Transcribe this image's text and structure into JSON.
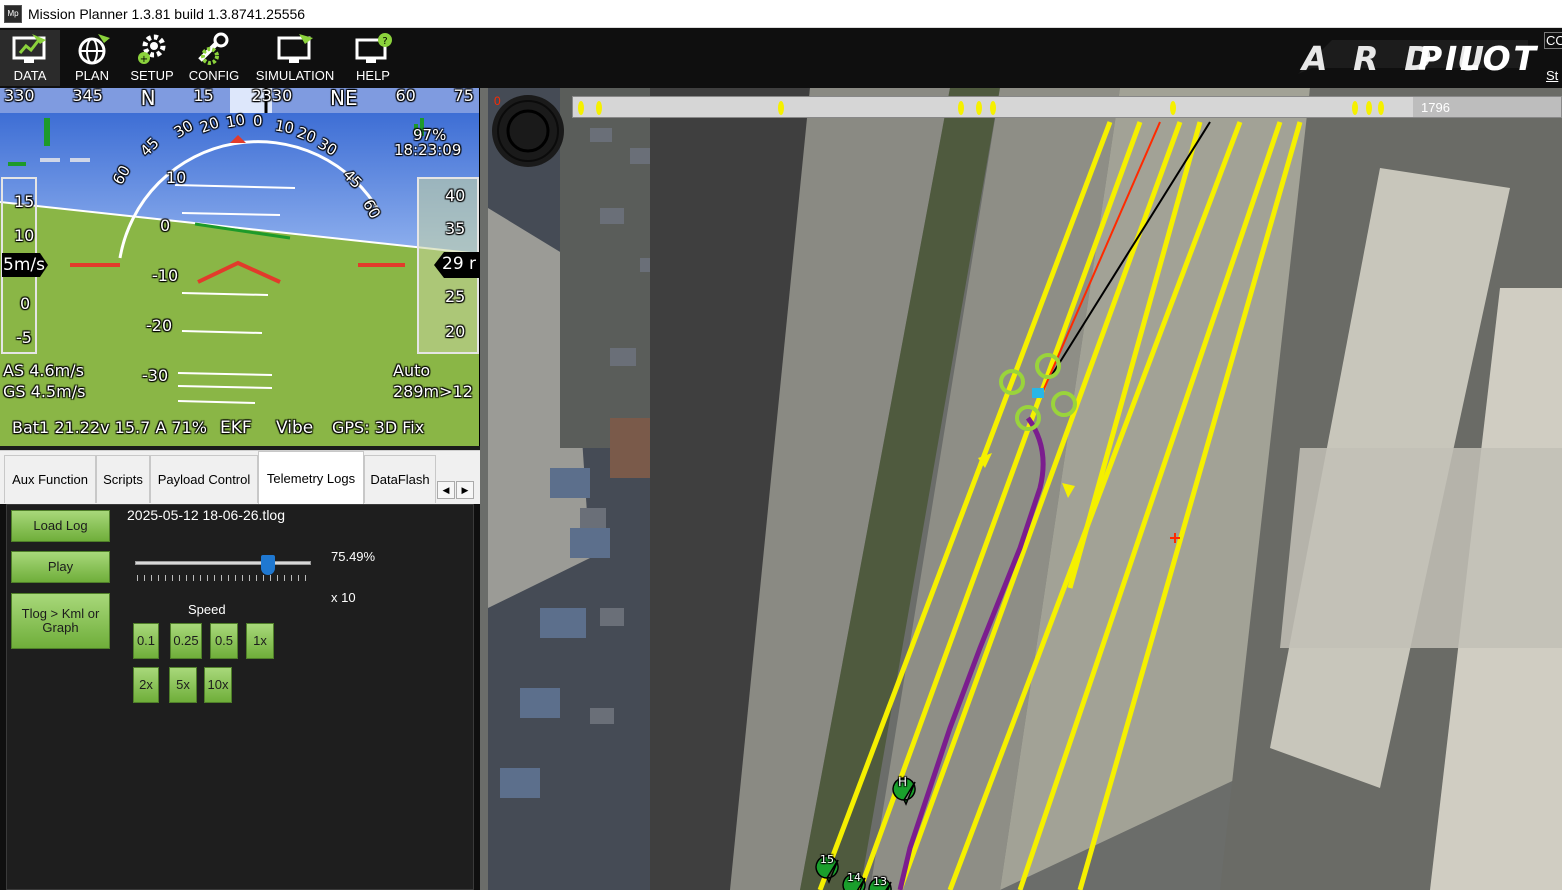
{
  "window": {
    "title": "Mission Planner 1.3.81 build 1.3.8741.25556",
    "icon_text": "Mp"
  },
  "toolbar": {
    "buttons": [
      {
        "label": "DATA",
        "icon": "data-monitor-icon"
      },
      {
        "label": "PLAN",
        "icon": "globe-icon"
      },
      {
        "label": "SETUP",
        "icon": "gears-icon"
      },
      {
        "label": "CONFIG",
        "icon": "wrench-icon"
      },
      {
        "label": "SIMULATION",
        "icon": "simulation-monitor-icon"
      },
      {
        "label": "HELP",
        "icon": "help-monitor-icon"
      }
    ],
    "active": "DATA",
    "logo": "ARDUPILOT",
    "side_text_top": "CO",
    "side_text_bottom": "St"
  },
  "hud": {
    "compass": [
      "330",
      "345",
      "N",
      "15",
      "2330",
      "NE",
      "60",
      "75"
    ],
    "roll_marks": [
      "60",
      "45",
      "30",
      "20",
      "10",
      "0",
      "10",
      "20",
      "30",
      "45",
      "60"
    ],
    "battery_signal": "97%",
    "clock": "18:23:09",
    "pitch_labels": [
      "10",
      "0",
      "-10",
      "-20",
      "-30"
    ],
    "speed_tape": [
      "15",
      "10",
      "0",
      "-5"
    ],
    "speed_value": "5m/s",
    "alt_tape": [
      "40",
      "35",
      "25",
      "20"
    ],
    "alt_value": "29 r",
    "airspeed": "AS 4.6m/s",
    "groundspeed": "GS 4.5m/s",
    "mode": "Auto",
    "wp_info": "289m>12",
    "status_line": "Bat1 21.22v 15.7 A 71%",
    "ekf": "EKF",
    "vibe": "Vibe",
    "gps": "GPS: 3D Fix",
    "colors": {
      "sky": "#3a6fd8",
      "ground": "#8ab646",
      "accent": "#e23b2b"
    }
  },
  "tabs": {
    "items": [
      "Aux Function",
      "Scripts",
      "Payload Control",
      "Telemetry Logs",
      "DataFlash"
    ],
    "active": "Telemetry Logs"
  },
  "telemetry": {
    "load_log": "Load Log",
    "play": "Play",
    "tlog_kml": "Tlog > Kml or Graph",
    "filename": "2025-05-12 18-06-26.tlog",
    "progress_text": "75.49%",
    "progress": 0.7549,
    "multiplier": "x 10",
    "speed_label": "Speed",
    "speed_buttons_row1": [
      "0.1",
      "0.25",
      "0.5",
      "1x"
    ],
    "speed_buttons_row2": [
      "2x",
      "5x",
      "10x"
    ]
  },
  "map": {
    "timeline_end": "1796",
    "timeline_start": "0",
    "timeline_position": 0.85,
    "waypoint_markers": [
      "H",
      "15",
      "14",
      "13"
    ],
    "colors": {
      "route": "#f5f000",
      "track": "#7b1d8e",
      "drone": "#9ad43b",
      "target": "#ff2a00"
    }
  }
}
